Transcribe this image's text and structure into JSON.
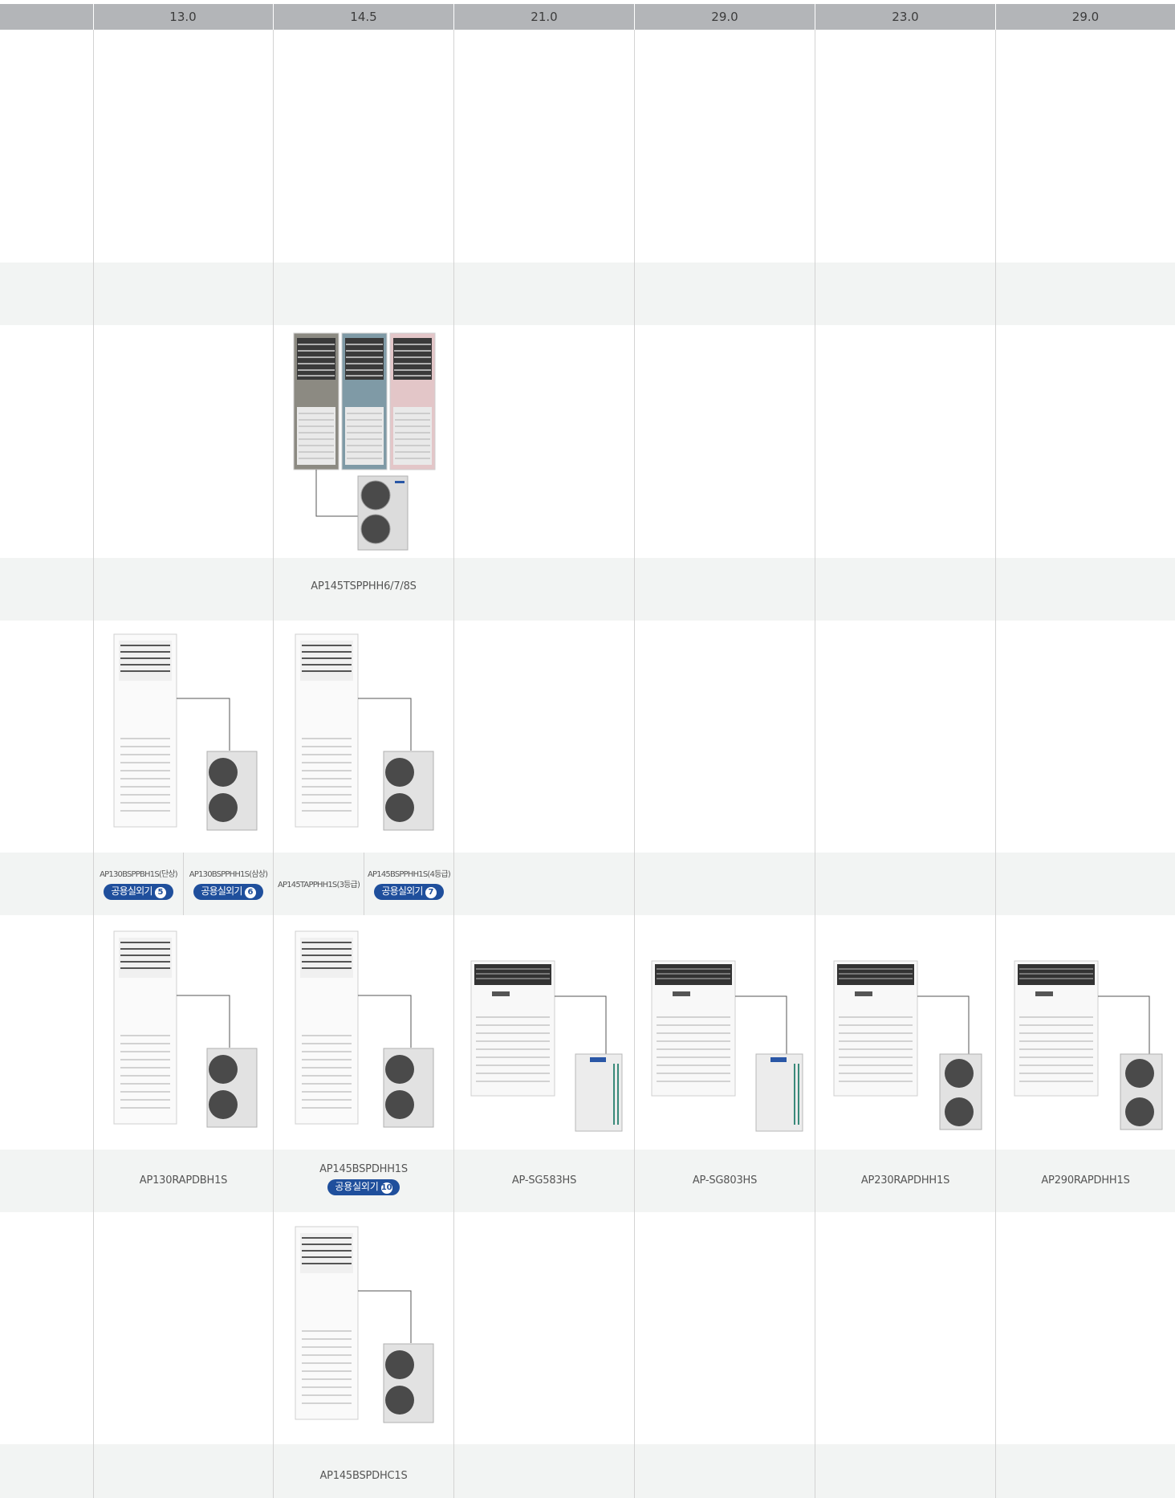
{
  "header": {
    "values": [
      "13.0",
      "14.5",
      "21.0",
      "29.0",
      "23.0",
      "29.0"
    ]
  },
  "rows": {
    "row2": {
      "model": "AP145TSPPHH6/7/8S"
    },
    "row3": {
      "col1a": {
        "model": "AP130BSPPBH1S(단상)",
        "badge": "공용실외기",
        "num": "5"
      },
      "col1b": {
        "model": "AP130BSPPHH1S(삼상)",
        "badge": "공용실외기",
        "num": "6"
      },
      "col2a": {
        "model": "AP145TAPPHH1S(3등급)"
      },
      "col2b": {
        "model": "AP145BSPPHH1S(4등급)",
        "badge": "공용실외기",
        "num": "7"
      }
    },
    "row4": {
      "col1": {
        "model": "AP130RAPDBH1S"
      },
      "col2": {
        "model": "AP145BSPDHH1S",
        "badge": "공용실외기",
        "num": "10"
      },
      "col3": {
        "model": "AP-SG583HS"
      },
      "col4": {
        "model": "AP-SG803HS"
      },
      "col5": {
        "model": "AP230RAPDHH1S"
      },
      "col6": {
        "model": "AP290RAPDHH1S"
      }
    },
    "row5": {
      "model": "AP145BSPDHC1S"
    }
  },
  "colors": {
    "header_bg": "#b3b5b8",
    "band_bg": "#f2f4f3",
    "badge_bg": "#1f4f9c"
  }
}
